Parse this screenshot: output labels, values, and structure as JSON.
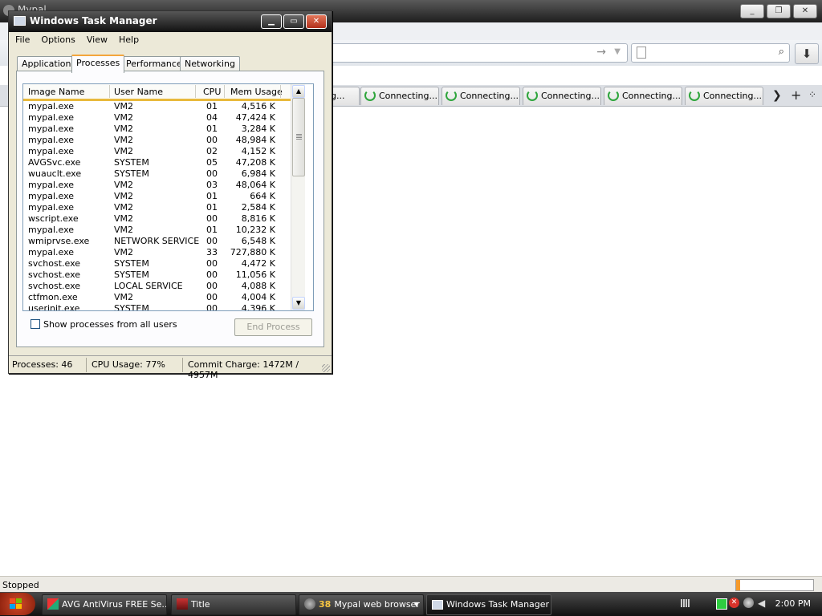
{
  "browser": {
    "title": "Mypal",
    "tab_label": "Connecting...",
    "first_tab_fragment": "ng...",
    "status_text": "Stopped",
    "progress_fraction": 0.05,
    "window_controls": [
      "_",
      "❐",
      "✕"
    ]
  },
  "task_manager": {
    "title": "Windows Task Manager",
    "menu": [
      "File",
      "Options",
      "View",
      "Help"
    ],
    "tabs": [
      "Applications",
      "Processes",
      "Performance",
      "Networking"
    ],
    "active_tab": "Processes",
    "columns": [
      "Image Name",
      "User Name",
      "CPU",
      "Mem Usage"
    ],
    "processes": [
      {
        "name": "mypal.exe",
        "user": "VM2",
        "cpu": "01",
        "mem": "4,516 K"
      },
      {
        "name": "mypal.exe",
        "user": "VM2",
        "cpu": "04",
        "mem": "47,424 K"
      },
      {
        "name": "mypal.exe",
        "user": "VM2",
        "cpu": "01",
        "mem": "3,284 K"
      },
      {
        "name": "mypal.exe",
        "user": "VM2",
        "cpu": "00",
        "mem": "48,984 K"
      },
      {
        "name": "mypal.exe",
        "user": "VM2",
        "cpu": "02",
        "mem": "4,152 K"
      },
      {
        "name": "AVGSvc.exe",
        "user": "SYSTEM",
        "cpu": "05",
        "mem": "47,208 K"
      },
      {
        "name": "wuauclt.exe",
        "user": "SYSTEM",
        "cpu": "00",
        "mem": "6,984 K"
      },
      {
        "name": "mypal.exe",
        "user": "VM2",
        "cpu": "03",
        "mem": "48,064 K"
      },
      {
        "name": "mypal.exe",
        "user": "VM2",
        "cpu": "01",
        "mem": "664 K"
      },
      {
        "name": "mypal.exe",
        "user": "VM2",
        "cpu": "01",
        "mem": "2,584 K"
      },
      {
        "name": "wscript.exe",
        "user": "VM2",
        "cpu": "00",
        "mem": "8,816 K"
      },
      {
        "name": "mypal.exe",
        "user": "VM2",
        "cpu": "01",
        "mem": "10,232 K"
      },
      {
        "name": "wmiprvse.exe",
        "user": "NETWORK SERVICE",
        "cpu": "00",
        "mem": "6,548 K"
      },
      {
        "name": "mypal.exe",
        "user": "VM2",
        "cpu": "33",
        "mem": "727,880 K"
      },
      {
        "name": "svchost.exe",
        "user": "SYSTEM",
        "cpu": "00",
        "mem": "4,472 K"
      },
      {
        "name": "svchost.exe",
        "user": "SYSTEM",
        "cpu": "00",
        "mem": "11,056 K"
      },
      {
        "name": "svchost.exe",
        "user": "LOCAL SERVICE",
        "cpu": "00",
        "mem": "4,088 K"
      },
      {
        "name": "ctfmon.exe",
        "user": "VM2",
        "cpu": "00",
        "mem": "4,004 K"
      },
      {
        "name": "userinit.exe",
        "user": "SYSTEM",
        "cpu": "00",
        "mem": "4,396 K"
      }
    ],
    "show_all_label": "Show processes from all users",
    "end_process_label": "End Process",
    "status": {
      "processes": "Processes: 46",
      "cpu": "CPU Usage: 77%",
      "commit": "Commit Charge: 1472M / 4957M"
    },
    "window_buttons": [
      "▁",
      "▭",
      "✕"
    ]
  },
  "taskbar": {
    "items": [
      {
        "label": "AVG AntiVirus FREE Se..."
      },
      {
        "label": "Title"
      },
      {
        "label": "Mypal web browser",
        "count": "38"
      },
      {
        "label": "Windows Task Manager"
      }
    ],
    "clock": "2:00 PM"
  },
  "colors": {
    "tab_spinner": "#2ea53c",
    "header_underline": "#e8b93c",
    "close_button": "#c0412a"
  }
}
